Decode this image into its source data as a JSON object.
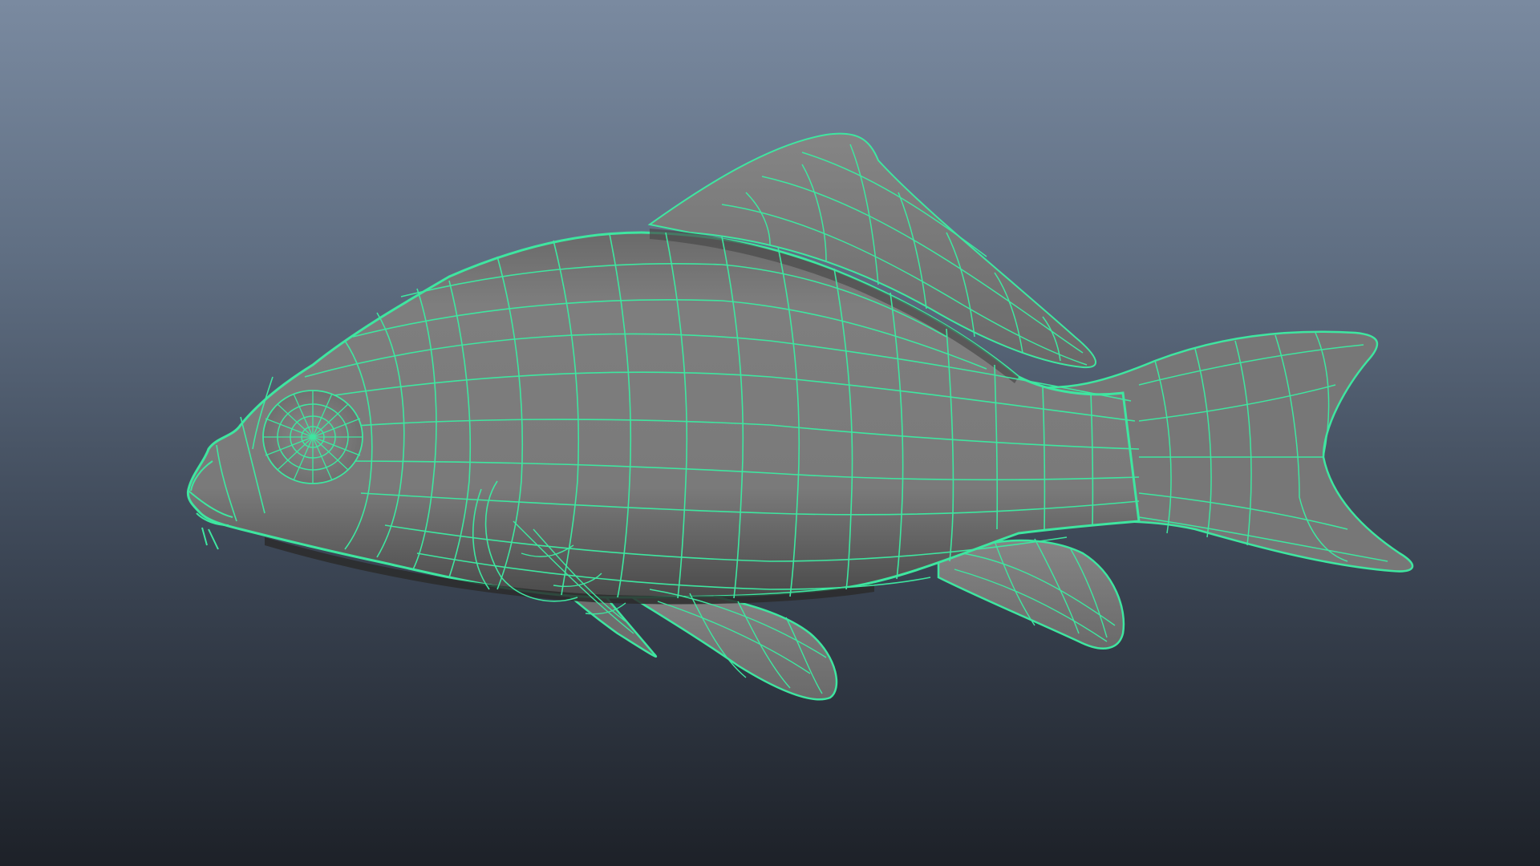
{
  "viewport": {
    "shading_mode": "wireframe-on-shaded",
    "colors": {
      "background_top": "#7a8aa0",
      "background_bottom": "#1d2128",
      "wireframe": "#3ee6a0",
      "mesh_surface": "#7c7c7c",
      "mesh_shadow": "#3a3a3a"
    },
    "model": {
      "subject": "carp fish",
      "view": "side"
    }
  }
}
